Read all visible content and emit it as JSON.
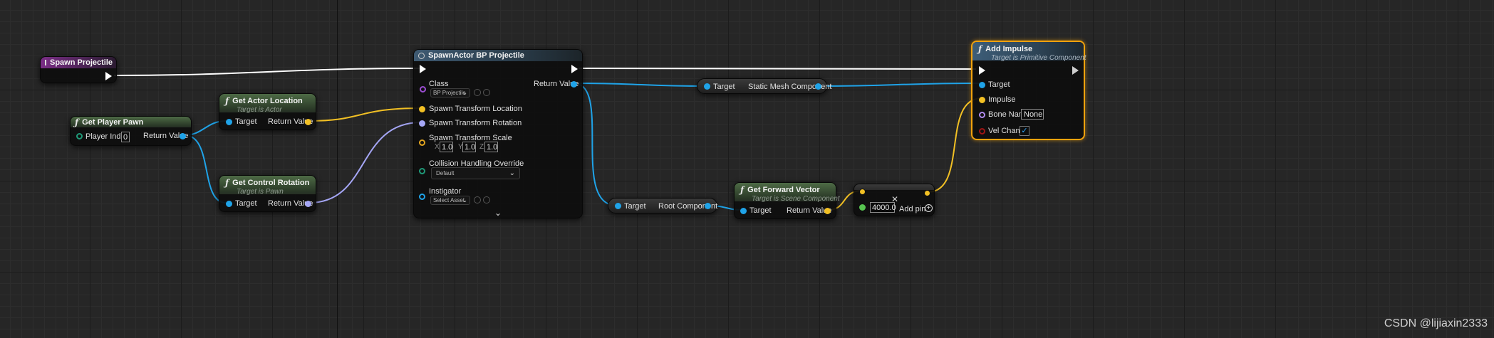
{
  "spawn_event": {
    "title": "Spawn Projectile"
  },
  "get_player_pawn": {
    "title": "Get Player Pawn",
    "player_index_label": "Player Index",
    "player_index_value": "0",
    "return_label": "Return Value"
  },
  "get_actor_location": {
    "title": "Get Actor Location",
    "subtitle": "Target is Actor",
    "target_label": "Target",
    "return_label": "Return Value"
  },
  "get_control_rotation": {
    "title": "Get Control Rotation",
    "subtitle": "Target is Pawn",
    "target_label": "Target",
    "return_label": "Return Value"
  },
  "spawn_actor": {
    "title": "SpawnActor BP Projectile",
    "class_label": "Class",
    "class_value": "BP Projectile",
    "return_label": "Return Value",
    "location_label": "Spawn Transform Location",
    "rotation_label": "Spawn Transform Rotation",
    "scale_label": "Spawn Transform Scale",
    "scale": {
      "x_label": "X",
      "x": "1.0",
      "y_label": "Y",
      "y": "1.0",
      "z_label": "Z",
      "z": "1.0"
    },
    "collision_label": "Collision Handling Override",
    "collision_value": "Default",
    "instigator_label": "Instigator",
    "instigator_value": "Select Asset"
  },
  "static_mesh_getter": {
    "target_label": "Target",
    "value_label": "Static Mesh Component"
  },
  "root_component_getter": {
    "target_label": "Target",
    "value_label": "Root Component"
  },
  "get_forward_vector": {
    "title": "Get Forward Vector",
    "subtitle": "Target is Scene Component",
    "target_label": "Target",
    "return_label": "Return Value"
  },
  "multiply": {
    "value": "4000.0",
    "add_pin_label": "Add pin"
  },
  "add_impulse": {
    "title": "Add Impulse",
    "subtitle": "Target is Primitive Component",
    "target_label": "Target",
    "impulse_label": "Impulse",
    "bone_name_label": "Bone Name",
    "bone_name_value": "None",
    "vel_change_label": "Vel Change",
    "vel_change_checked": "✓"
  },
  "watermark": "CSDN @lijiaxin2333",
  "icons": [
    "event-icon",
    "function-icon",
    "spawn-icon",
    "exec-pin-icon",
    "browse-icon",
    "use-asset-icon",
    "chevron-down-icon",
    "close-icon",
    "add-pin-icon",
    "checkbox-check-icon"
  ],
  "colors": {
    "object_pin": "#1fa3e8",
    "vector_pin": "#f2c024",
    "rotator_pin": "#a5a6f5",
    "float_pin": "#57c450",
    "selection": "#f2a20d",
    "event_header": "#7a2d86",
    "pure_header": "#4d6a45"
  }
}
